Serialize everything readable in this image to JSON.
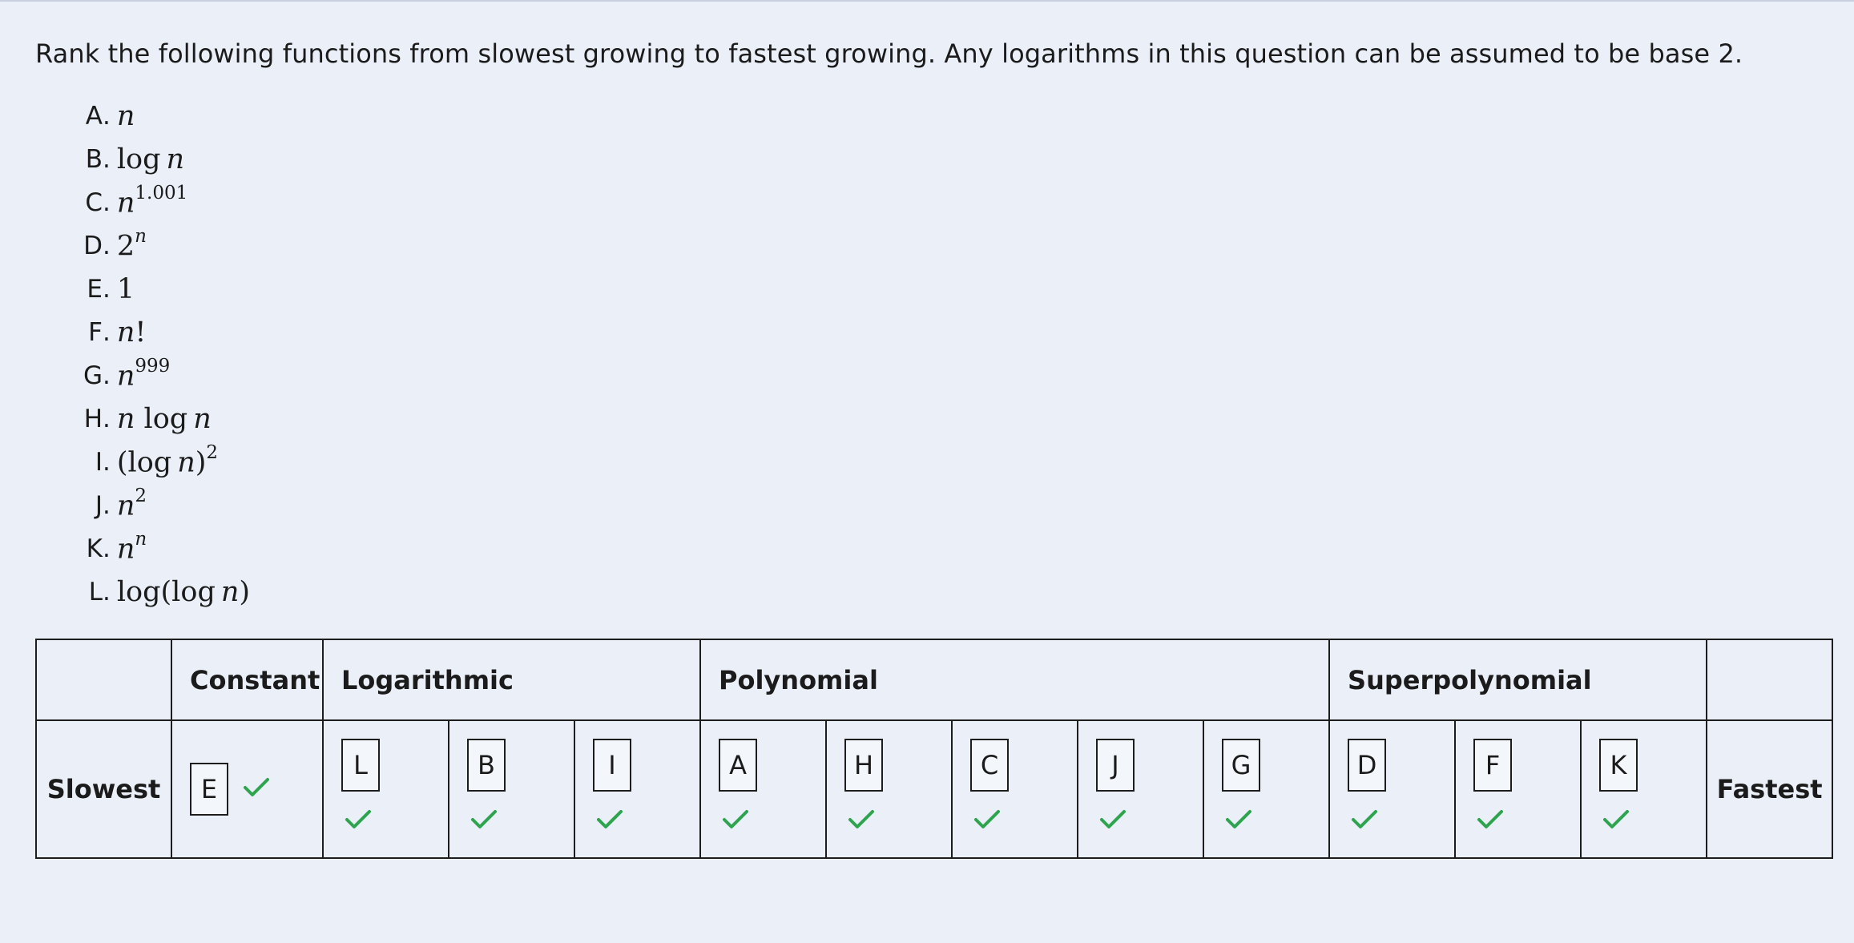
{
  "prompt": "Rank the following functions from slowest growing to fastest growing. Any logarithms in this question can be assumed to be base 2.",
  "options": [
    {
      "letter": "A",
      "math": "n"
    },
    {
      "letter": "B",
      "math": "log n"
    },
    {
      "letter": "C",
      "math": "n^1.001"
    },
    {
      "letter": "D",
      "math": "2^n"
    },
    {
      "letter": "E",
      "math": "1"
    },
    {
      "letter": "F",
      "math": "n!"
    },
    {
      "letter": "G",
      "math": "n^999"
    },
    {
      "letter": "H",
      "math": "n log n"
    },
    {
      "letter": "I",
      "math": "(log n)^2"
    },
    {
      "letter": "J",
      "math": "n^2"
    },
    {
      "letter": "K",
      "math": "n^n"
    },
    {
      "letter": "L",
      "math": "log(log n)"
    }
  ],
  "table": {
    "categories": {
      "constant": "Constant",
      "logarithmic": "Logarithmic",
      "polynomial": "Polynomial",
      "superpolynomial": "Superpolynomial"
    },
    "slowest_label": "Slowest",
    "fastest_label": "Fastest",
    "ranking": [
      "E",
      "L",
      "B",
      "I",
      "A",
      "H",
      "C",
      "J",
      "G",
      "D",
      "F",
      "K"
    ],
    "correct": [
      true,
      true,
      true,
      true,
      true,
      true,
      true,
      true,
      true,
      true,
      true,
      true
    ]
  },
  "colors": {
    "check": "#2ea44f",
    "background": "#eaeff8"
  }
}
